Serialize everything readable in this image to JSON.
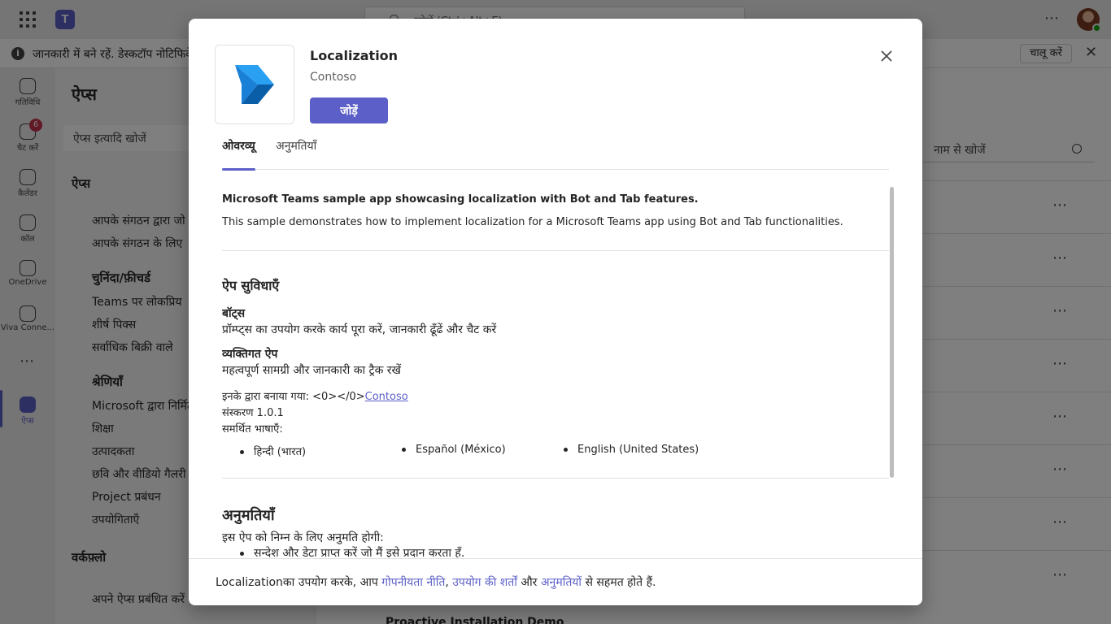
{
  "titlebar": {
    "search_placeholder": "खोजें (Ctrl+Alt+E)"
  },
  "notification": {
    "message": "जानकारी में बने रहें. डेस्कटॉप नोटिफिकेशन चालू करें.",
    "enable_label": "चालू करें"
  },
  "rail": {
    "items": [
      {
        "label": "गतिविधि",
        "icon": "bell-icon"
      },
      {
        "label": "चैट करें",
        "icon": "chat-icon",
        "badge": "6"
      },
      {
        "label": "कैलेंडर",
        "icon": "calendar-icon"
      },
      {
        "label": "कॉल",
        "icon": "phone-icon"
      },
      {
        "label": "OneDrive",
        "icon": "cloud-icon"
      },
      {
        "label": "Viva Conne...",
        "icon": "viva-icon"
      },
      {
        "label": "ऐप्स",
        "icon": "apps-icon"
      }
    ],
    "more": "⋯"
  },
  "leftpane": {
    "title": "ऐप्स",
    "search_placeholder": "ऐप्स इत्यादि खोजें",
    "apps_heading": "ऐप्स",
    "org_items": [
      "आपके संगठन द्वारा जो",
      "आपके संगठन के लिए"
    ],
    "featured_heading": "चुनिंदा/फ़ीचर्ड",
    "featured_items": [
      "Teams पर लोकप्रिय",
      "शीर्ष पिक्स",
      "सर्वाधिक बिक्री वाले"
    ],
    "categories_heading": "श्रेणियाँ",
    "category_items": [
      "Microsoft द्वारा निर्मित",
      "शिक्षा",
      "उत्पादकता",
      "छवि और वीडियो गैलरी",
      "Project प्रबंधन",
      "उपयोगिताएँ"
    ],
    "workflows_heading": "वर्कफ़्लो",
    "manage_label": "अपने ऐप्स प्रबंधित करें"
  },
  "mainpane": {
    "search_placeholder": "नाम से खोजें",
    "bottom_item": "Proactive Installation Demo"
  },
  "modal": {
    "app_name": "Localization",
    "publisher": "Contoso",
    "add_label": "जोड़ें",
    "tabs": [
      "ओवरव्यू",
      "अनुमतियाँ"
    ],
    "description_title": "Microsoft Teams sample app showcasing localization with Bot and Tab features.",
    "description_text": "This sample demonstrates how to implement localization for a Microsoft Teams app using Bot and Tab functionalities.",
    "features_heading": "ऐप सुविधाएँ",
    "features": [
      {
        "name": "बॉट्स",
        "desc": "प्रॉम्प्ट्स का उपयोग करके कार्य पूरा करें, जानकारी ढूँढें और चैट करें"
      },
      {
        "name": "व्यक्तिगत ऐप",
        "desc": "महत्वपूर्ण सामग्री और जानकारी का ट्रैक रखें"
      }
    ],
    "created_by_prefix": "इनके द्वारा बनाया गया: <0></0>",
    "created_by_link": "Contoso",
    "version": "संस्करण 1.0.1",
    "languages_label": "समर्थित भाषाएँ:",
    "languages": [
      "हिन्दी (भारत)",
      "Español (México)",
      "English (United States)"
    ],
    "permissions_heading": "अनुमतियाँ",
    "permissions_intro": "इस ऐप को निम्न के लिए अनुमति होगी:",
    "permissions_item": "सन्देश और डेटा प्राप्त करें जो मैं इसे प्रदान करता हूँ.",
    "footer": {
      "prefix": "Localizationका उपयोग करके, आप ",
      "privacy_link": "गोपनीयता नीति",
      "sep": ", ",
      "terms_link": "उपयोग की शर्तों",
      "and": " और ",
      "perms_link": "अनुमतियों",
      "suffix": " से सहमत होते हैं."
    }
  },
  "colors": {
    "accent": "#5b5fc7",
    "overlay": "rgba(0,0,0,0.5)"
  }
}
